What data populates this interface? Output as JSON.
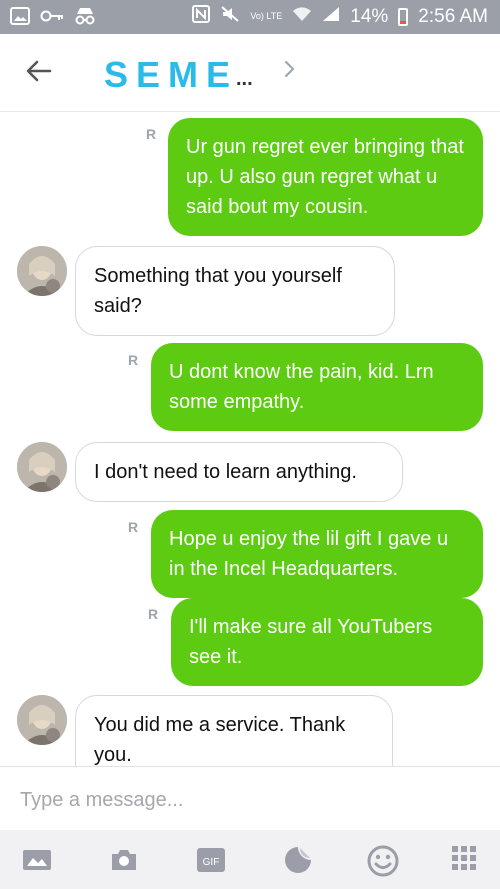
{
  "status_bar": {
    "vo_lte": "Vo) LTE",
    "battery_percent": "14%",
    "time": "2:56 AM",
    "colors": {
      "bar": "#9a9fa8",
      "battery_low": "#ff4d4d"
    }
  },
  "header": {
    "title": "SEME",
    "ellipsis": "...",
    "back_icon": "arrow-left-icon",
    "more_icon": "chevron-right-icon",
    "title_color": "#2bbbe8"
  },
  "messages": [
    {
      "from": "me",
      "text": "Ur gun regret ever bringing that up. U also gun regret what u said bout my cousin.",
      "receipt": "R"
    },
    {
      "from": "them",
      "text": "Something that you yourself said?"
    },
    {
      "from": "me",
      "text": "U dont know the pain, kid. Lrn some empathy.",
      "receipt": "R"
    },
    {
      "from": "them",
      "text": "I don't need to learn anything."
    },
    {
      "from": "me",
      "text": "Hope u enjoy the lil gift I gave u in the Incel Headquarters.",
      "receipt": "R"
    },
    {
      "from": "me",
      "text": "I'll make sure all YouTubers see it.",
      "receipt": "R"
    },
    {
      "from": "them",
      "text": "You did me a service. Thank you."
    }
  ],
  "colors": {
    "outgoing_bubble": "#5ccb11",
    "incoming_border": "#d8d8dc"
  },
  "input": {
    "placeholder": "Type a message..."
  },
  "toolbar": {
    "gif_label": "GIF",
    "icons": [
      "image-icon",
      "camera-icon",
      "gif-icon",
      "sticker-icon",
      "emoji-icon",
      "grid-icon"
    ]
  }
}
